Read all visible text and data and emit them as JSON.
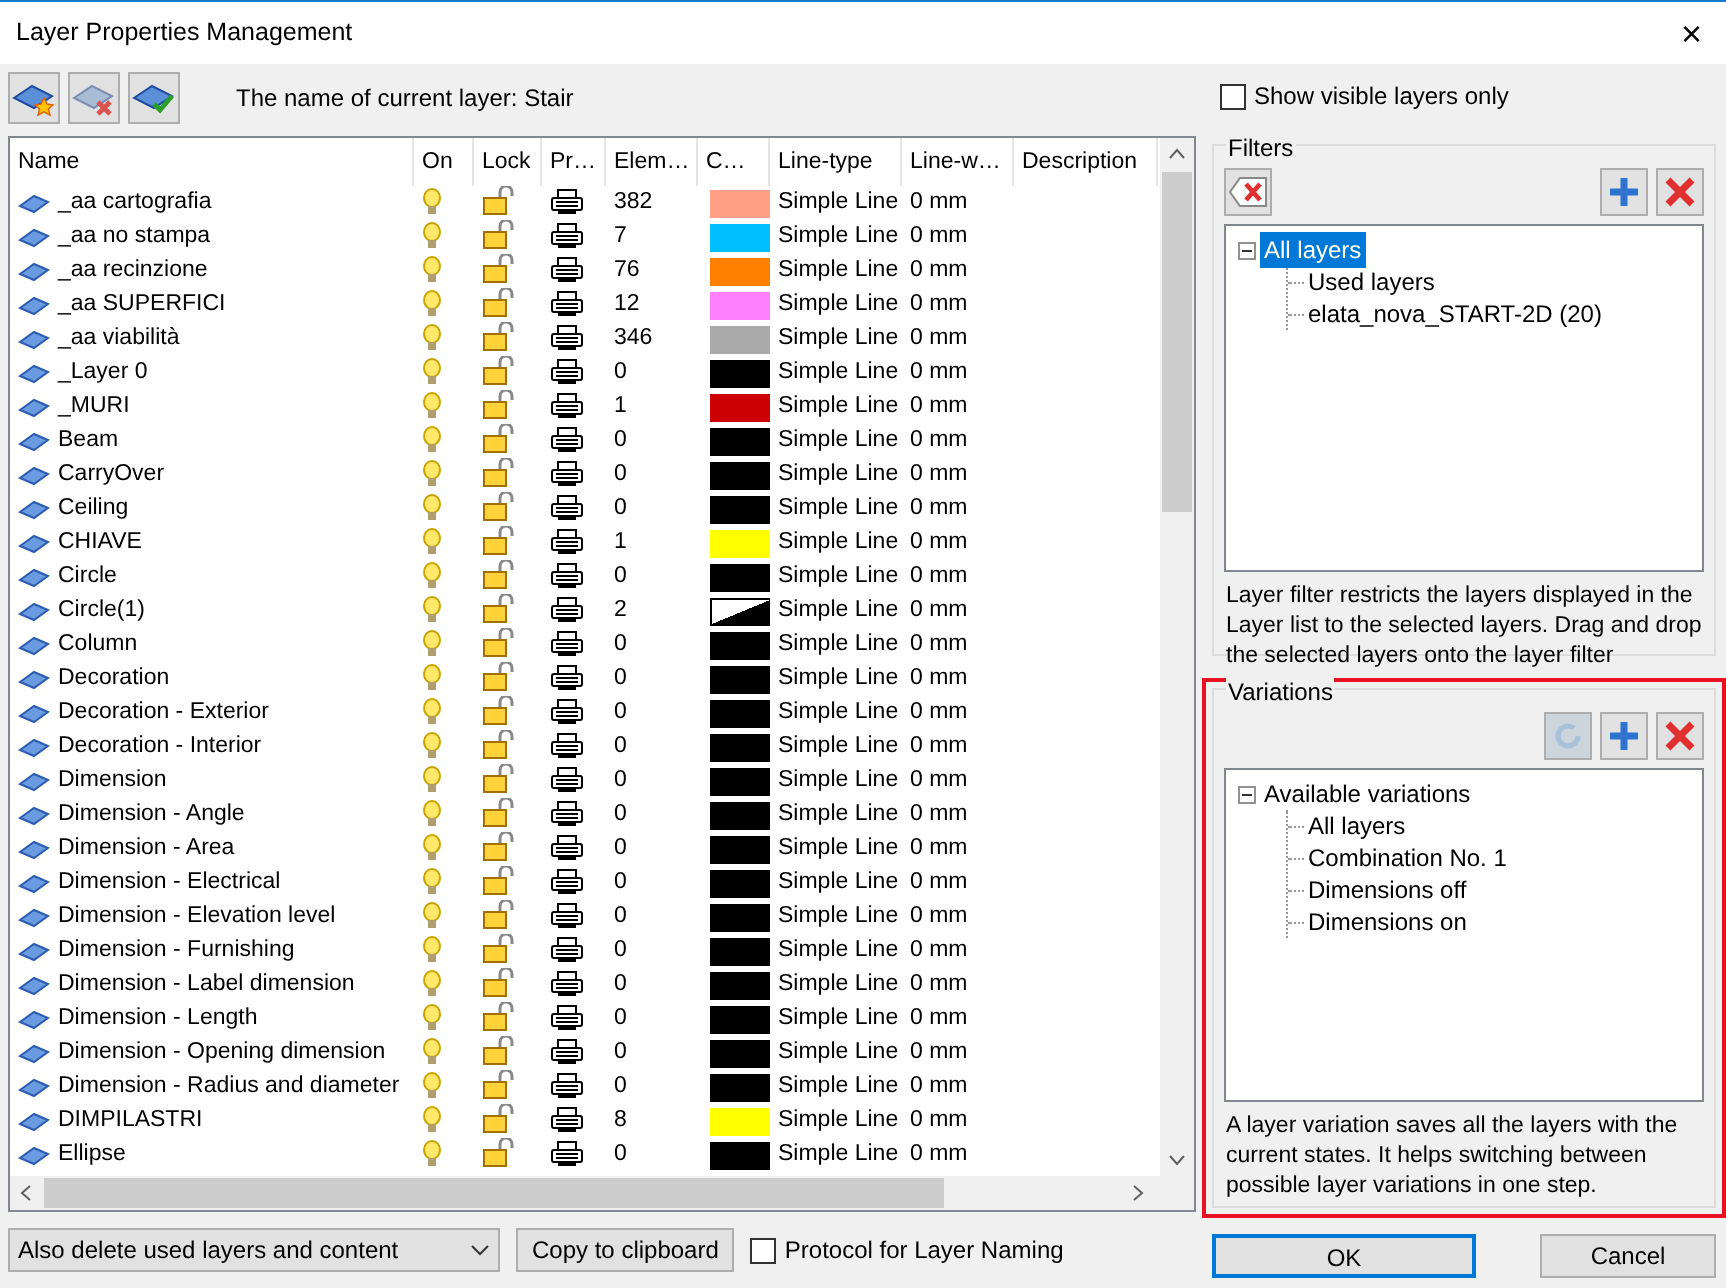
{
  "window": {
    "title": "Layer Properties Management",
    "close": "×"
  },
  "toolbar": {
    "current_layer_label": "The name of current layer: Stair"
  },
  "table": {
    "columns": [
      "Name",
      "On",
      "Lock",
      "Pr…",
      "Elem…",
      "C…",
      "Line-type",
      "Line-w…",
      "Description"
    ],
    "rows": [
      {
        "name": "_aa cartografia",
        "elements": "382",
        "kind": "solid",
        "color": "#ff9f86",
        "line_type": "Simple Line",
        "line_width": "0 mm"
      },
      {
        "name": "_aa no stampa",
        "elements": "7",
        "kind": "solid",
        "color": "#00bfff",
        "line_type": "Simple Line",
        "line_width": "0 mm"
      },
      {
        "name": "_aa recinzione",
        "elements": "76",
        "kind": "solid",
        "color": "#ff8000",
        "line_type": "Simple Line",
        "line_width": "0 mm"
      },
      {
        "name": "_aa SUPERFICI",
        "elements": "12",
        "kind": "solid",
        "color": "#ff80ff",
        "line_type": "Simple Line",
        "line_width": "0 mm"
      },
      {
        "name": "_aa viabilità",
        "elements": "346",
        "kind": "solid",
        "color": "#aaaaaa",
        "line_type": "Simple Line",
        "line_width": "0 mm"
      },
      {
        "name": "_Layer 0",
        "elements": "0",
        "kind": "solid",
        "color": "#000000",
        "line_type": "Simple Line",
        "line_width": "0 mm"
      },
      {
        "name": "_MURI",
        "elements": "1",
        "kind": "solid",
        "color": "#cc0000",
        "line_type": "Simple Line",
        "line_width": "0 mm"
      },
      {
        "name": "Beam",
        "elements": "0",
        "kind": "solid",
        "color": "#000000",
        "line_type": "Simple Line",
        "line_width": "0 mm"
      },
      {
        "name": "CarryOver",
        "elements": "0",
        "kind": "solid",
        "color": "#000000",
        "line_type": "Simple Line",
        "line_width": "0 mm"
      },
      {
        "name": "Ceiling",
        "elements": "0",
        "kind": "solid",
        "color": "#000000",
        "line_type": "Simple Line",
        "line_width": "0 mm"
      },
      {
        "name": "CHIAVE",
        "elements": "1",
        "kind": "solid",
        "color": "#ffff00",
        "line_type": "Simple Line",
        "line_width": "0 mm"
      },
      {
        "name": "Circle",
        "elements": "0",
        "kind": "solid",
        "color": "#000000",
        "line_type": "Simple Line",
        "line_width": "0 mm"
      },
      {
        "name": "Circle(1)",
        "elements": "2",
        "kind": "split",
        "color": "#000000",
        "line_type": "Simple Line",
        "line_width": "0 mm"
      },
      {
        "name": "Column",
        "elements": "0",
        "kind": "solid",
        "color": "#000000",
        "line_type": "Simple Line",
        "line_width": "0 mm"
      },
      {
        "name": "Decoration",
        "elements": "0",
        "kind": "solid",
        "color": "#000000",
        "line_type": "Simple Line",
        "line_width": "0 mm"
      },
      {
        "name": "Decoration - Exterior",
        "elements": "0",
        "kind": "solid",
        "color": "#000000",
        "line_type": "Simple Line",
        "line_width": "0 mm"
      },
      {
        "name": "Decoration - Interior",
        "elements": "0",
        "kind": "solid",
        "color": "#000000",
        "line_type": "Simple Line",
        "line_width": "0 mm"
      },
      {
        "name": "Dimension",
        "elements": "0",
        "kind": "solid",
        "color": "#000000",
        "line_type": "Simple Line",
        "line_width": "0 mm"
      },
      {
        "name": "Dimension - Angle",
        "elements": "0",
        "kind": "solid",
        "color": "#000000",
        "line_type": "Simple Line",
        "line_width": "0 mm"
      },
      {
        "name": "Dimension - Area",
        "elements": "0",
        "kind": "solid",
        "color": "#000000",
        "line_type": "Simple Line",
        "line_width": "0 mm"
      },
      {
        "name": "Dimension - Electrical",
        "elements": "0",
        "kind": "solid",
        "color": "#000000",
        "line_type": "Simple Line",
        "line_width": "0 mm"
      },
      {
        "name": "Dimension - Elevation level",
        "elements": "0",
        "kind": "solid",
        "color": "#000000",
        "line_type": "Simple Line",
        "line_width": "0 mm"
      },
      {
        "name": "Dimension - Furnishing",
        "elements": "0",
        "kind": "solid",
        "color": "#000000",
        "line_type": "Simple Line",
        "line_width": "0 mm"
      },
      {
        "name": "Dimension - Label dimension",
        "elements": "0",
        "kind": "solid",
        "color": "#000000",
        "line_type": "Simple Line",
        "line_width": "0 mm"
      },
      {
        "name": "Dimension - Length",
        "elements": "0",
        "kind": "solid",
        "color": "#000000",
        "line_type": "Simple Line",
        "line_width": "0 mm"
      },
      {
        "name": "Dimension - Opening dimension",
        "elements": "0",
        "kind": "solid",
        "color": "#000000",
        "line_type": "Simple Line",
        "line_width": "0 mm"
      },
      {
        "name": "Dimension - Radius and diameter",
        "elements": "0",
        "kind": "solid",
        "color": "#000000",
        "line_type": "Simple Line",
        "line_width": "0 mm"
      },
      {
        "name": "DIMPILASTRI",
        "elements": "8",
        "kind": "solid",
        "color": "#ffff00",
        "line_type": "Simple Line",
        "line_width": "0 mm"
      },
      {
        "name": "Ellipse",
        "elements": "0",
        "kind": "solid",
        "color": "#000000",
        "line_type": "Simple Line",
        "line_width": "0 mm"
      }
    ]
  },
  "bottom": {
    "delete_option": "Also delete used layers and content",
    "copy_button": "Copy to clipboard",
    "protocol": {
      "label": "Protocol for Layer Naming",
      "checked": false
    }
  },
  "show_visible": {
    "label": "Show visible layers only",
    "checked": false
  },
  "filters": {
    "title": "Filters",
    "tree": {
      "label": "All layers",
      "expanded": true,
      "selected": true,
      "children": [
        {
          "label": "Used layers",
          "selected": false
        },
        {
          "label": "elata_nova_START-2D (20)",
          "selected": false
        }
      ]
    },
    "description": "Layer filter restricts the layers displayed in the Layer list to the selected layers. Drag and drop the selected layers onto the layer filter"
  },
  "variations": {
    "title": "Variations",
    "highlighted": true,
    "tree": {
      "label": "Available variations",
      "expanded": true,
      "selected": false,
      "children": [
        {
          "label": "All layers",
          "selected": false
        },
        {
          "label": "Combination No. 1",
          "selected": false
        },
        {
          "label": "Dimensions off",
          "selected": false
        },
        {
          "label": "Dimensions on",
          "selected": false
        }
      ]
    },
    "description": "A layer variation saves all the layers with the current states. It helps switching between possible layer variations in one step."
  },
  "buttons": {
    "ok": "OK",
    "cancel": "Cancel"
  }
}
